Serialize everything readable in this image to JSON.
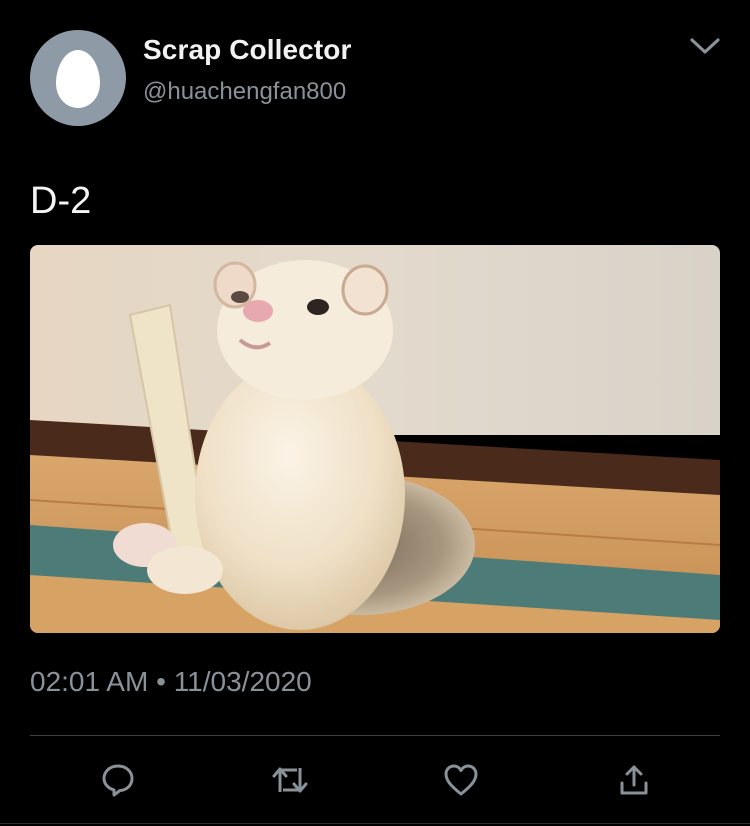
{
  "author": {
    "display_name": "Scrap Collector",
    "handle": "@huachengfan800"
  },
  "tweet": {
    "text": "D-2",
    "media_icon": "ferret-photo",
    "time": "02:01 AM",
    "separator": "•",
    "date": "11/03/2020"
  },
  "actions": [
    {
      "icon": "reply-icon"
    },
    {
      "icon": "retweet-icon"
    },
    {
      "icon": "like-icon"
    },
    {
      "icon": "share-icon"
    }
  ],
  "colors": {
    "background": "#000000",
    "secondary_text": "#8a9299",
    "avatar_bg": "#8e9aa5",
    "icon": "#8a9299"
  }
}
